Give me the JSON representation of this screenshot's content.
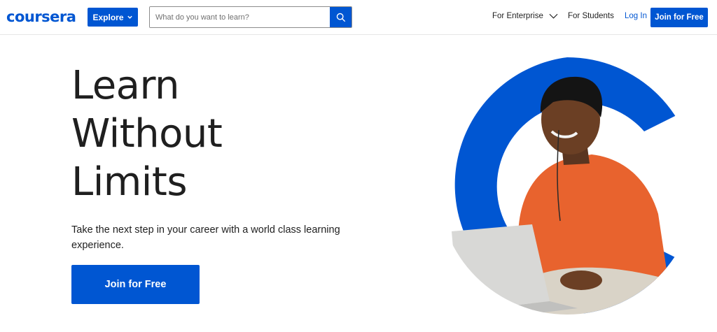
{
  "header": {
    "logo": "coursera",
    "explore_label": "Explore",
    "search_placeholder": "What do you want to learn?",
    "nav": {
      "enterprise": "For Enterprise",
      "students": "For Students",
      "login": "Log In",
      "join": "Join for Free"
    }
  },
  "hero": {
    "title_lines": [
      "Learn",
      "Without",
      "Limits"
    ],
    "subtitle": "Take the next step in your career with a world class learning experience.",
    "cta": "Join for Free"
  },
  "icons": {
    "search": "search-icon",
    "explore_chevron": "chevron-down-icon",
    "enterprise_chevron": "chevron-down-icon"
  },
  "colors": {
    "brand": "#0056d2",
    "text": "#1f1f1f",
    "shirt": "#e8632e"
  }
}
